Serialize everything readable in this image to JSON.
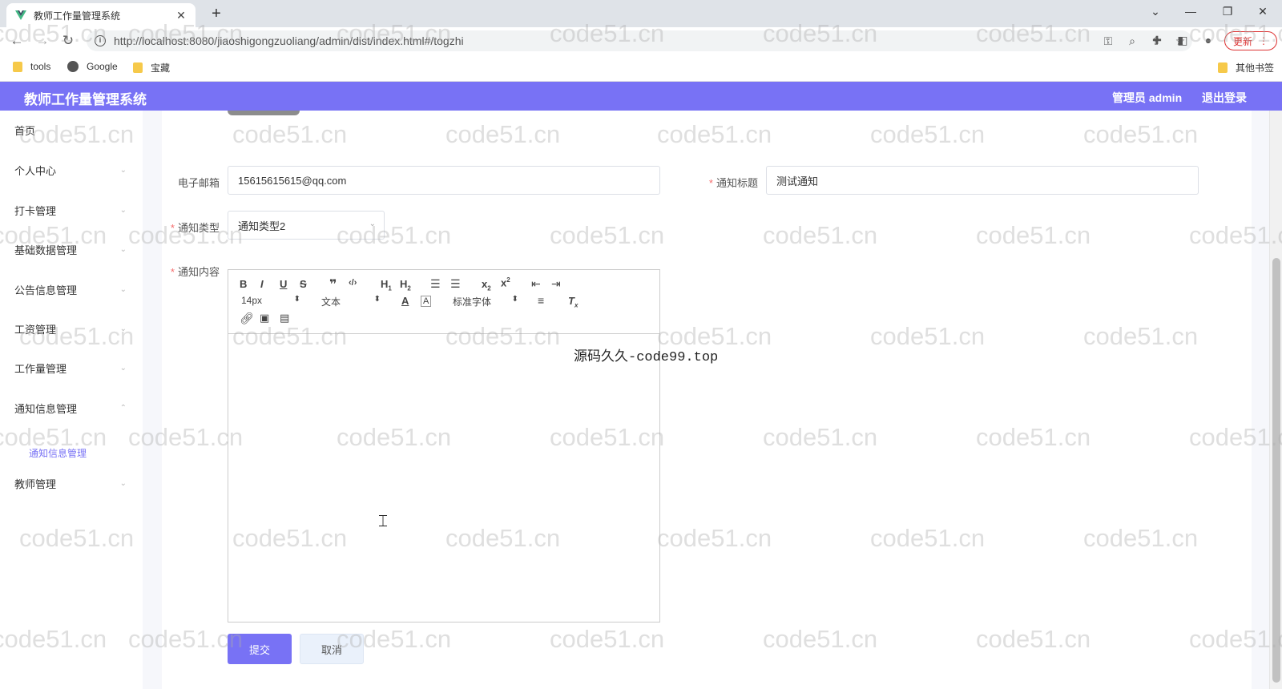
{
  "browser": {
    "tab_title": "教师工作量管理系统",
    "tab_close": "✕",
    "new_tab": "+",
    "url": "http://localhost:8080/jiaoshigongzuoliang/admin/dist/index.html#/togzhi",
    "update_label": "更新",
    "bookmarks": [
      "tools",
      "Google",
      "宝藏"
    ],
    "other_bookmarks": "其他书签"
  },
  "header": {
    "title": "教师工作量管理系统",
    "user": "管理员 admin",
    "logout": "退出登录"
  },
  "sidebar": {
    "items": [
      {
        "label": "首页"
      },
      {
        "label": "个人中心"
      },
      {
        "label": "打卡管理"
      },
      {
        "label": "基础数据管理"
      },
      {
        "label": "公告信息管理"
      },
      {
        "label": "工资管理"
      },
      {
        "label": "工作量管理"
      },
      {
        "label": "通知信息管理"
      },
      {
        "label": "教师管理"
      }
    ],
    "sub_item": "通知信息管理"
  },
  "form": {
    "email_label": "电子邮箱",
    "email_value": "15615615615@qq.com",
    "title_label": "通知标题",
    "title_value": "测试通知",
    "type_label": "通知类型",
    "type_value": "通知类型2",
    "content_label": "通知内容",
    "required_mark": "*",
    "submit": "提交",
    "cancel": "取消"
  },
  "editor": {
    "size_value": "14px",
    "header_value": "文本",
    "font_value": "标准字体",
    "content": ""
  },
  "overlay_text": "源码久久-code99.top",
  "watermark_text": "code51.cn",
  "colors": {
    "accent": "#7872f5",
    "required": "#f56c6c"
  }
}
